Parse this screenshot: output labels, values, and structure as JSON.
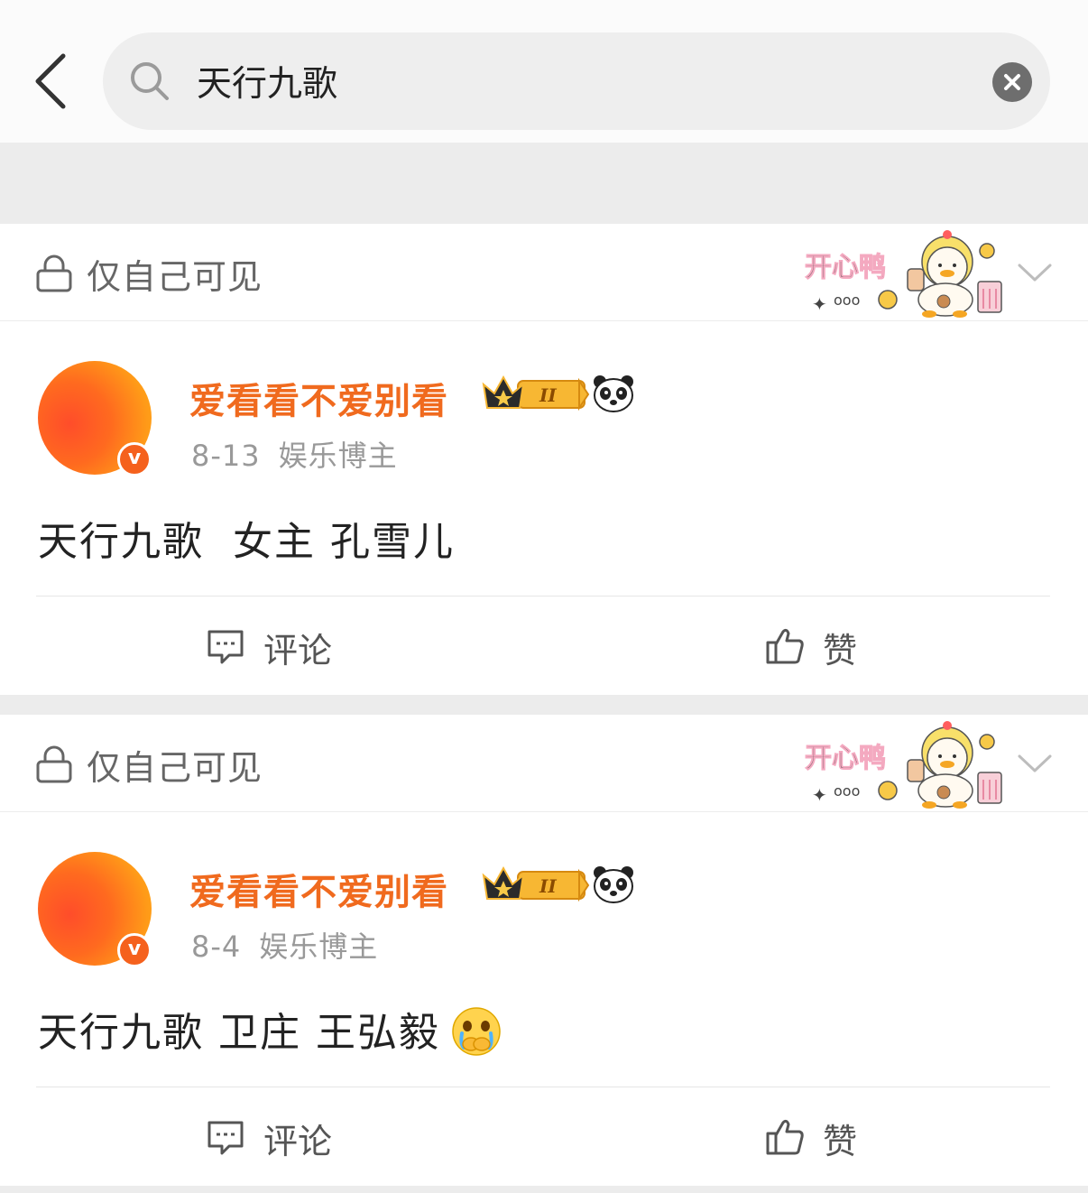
{
  "search": {
    "query": "天行九歌",
    "back_icon": "chevron-left-icon",
    "search_icon": "magnifier-icon",
    "clear_icon": "close-circle-icon"
  },
  "colors": {
    "accent_orange": "#f06a1e",
    "badge_orange": "#f5611d",
    "grey_band": "#ececec"
  },
  "posts": [
    {
      "visibility": "仅自己可见",
      "sticker_text": "开心鸭",
      "author": "爱看看不爱别看",
      "member_level": "II",
      "date": "8-13",
      "author_tag": "娱乐博主",
      "text": "天行九歌  女主 孔雪儿",
      "comment_label": "评论",
      "like_label": "赞"
    },
    {
      "visibility": "仅自己可见",
      "sticker_text": "开心鸭",
      "author": "爱看看不爱别看",
      "member_level": "II",
      "date": "8-4",
      "author_tag": "娱乐博主",
      "text": "天行九歌 卫庄 王弘毅",
      "text_emoji": "crying-face-emoji",
      "comment_label": "评论",
      "like_label": "赞"
    }
  ]
}
